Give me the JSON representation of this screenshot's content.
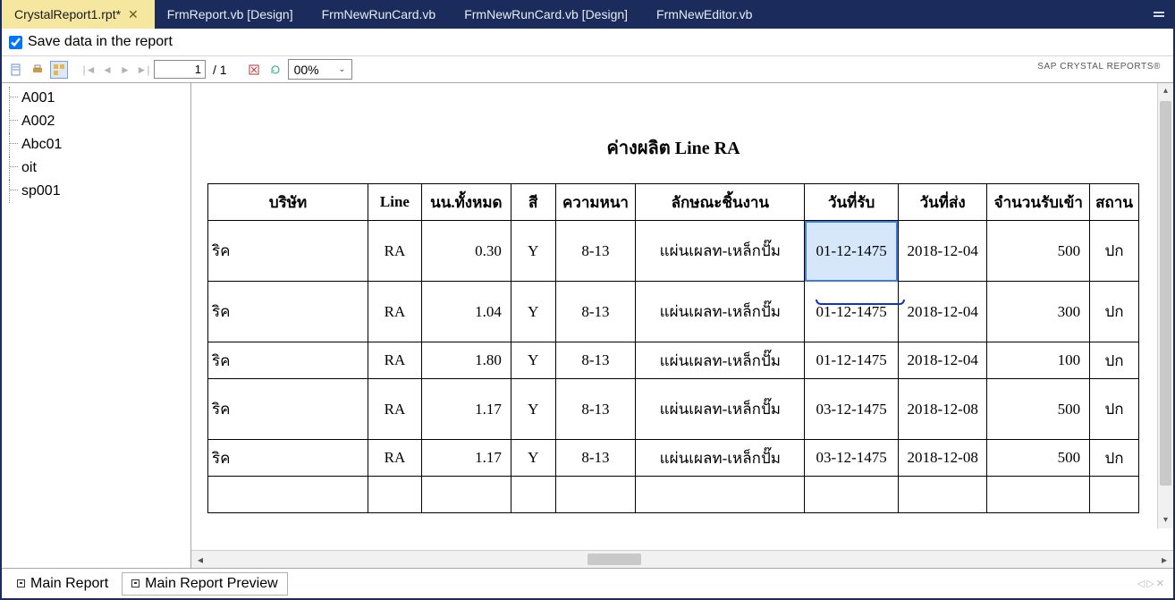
{
  "tabs": [
    {
      "label": "CrystalReport1.rpt*",
      "active": true
    },
    {
      "label": "FrmReport.vb [Design]",
      "active": false
    },
    {
      "label": "FrmNewRunCard.vb",
      "active": false
    },
    {
      "label": "FrmNewRunCard.vb [Design]",
      "active": false
    },
    {
      "label": "FrmNewEditor.vb",
      "active": false
    }
  ],
  "save_data_label": "Save data in the report",
  "save_data_checked": true,
  "page_current": "1",
  "page_total": "/ 1",
  "zoom": "00%",
  "brand": "SAP CRYSTAL REPORTS®",
  "tree_items": [
    "A001",
    "A002",
    "Abc01",
    "oit",
    "sp001"
  ],
  "report": {
    "title": "ค่างผลิต Line RA",
    "headers": [
      "บริษัท",
      "Line",
      "นน.ทั้งหมด",
      "สี",
      "ความหนา",
      "ลักษณะชิ้นงาน",
      "วันที่รับ",
      "วันที่ส่ง",
      "จำนวนรับเข้า",
      "สถาน"
    ],
    "rows": [
      {
        "company": "ริค",
        "line": "RA",
        "weight": "0.30",
        "color": "Y",
        "thick": "8-13",
        "desc": "แผ่นเผลท-เหล็กปั๊ม",
        "recv": "01-12-1475",
        "send": "2018-12-04",
        "qty": "500",
        "status": "ปก",
        "tall": true,
        "hl": true
      },
      {
        "company": "ริค",
        "line": "RA",
        "weight": "1.04",
        "color": "Y",
        "thick": "8-13",
        "desc": "แผ่นเผลท-เหล็กปั๊ม",
        "recv": "01-12-1475",
        "send": "2018-12-04",
        "qty": "300",
        "status": "ปก",
        "tall": true
      },
      {
        "company": "ริค",
        "line": "RA",
        "weight": "1.80",
        "color": "Y",
        "thick": "8-13",
        "desc": "แผ่นเผลท-เหล็กปั๊ม",
        "recv": "01-12-1475",
        "send": "2018-12-04",
        "qty": "100",
        "status": "ปก"
      },
      {
        "company": "ริค",
        "line": "RA",
        "weight": "1.17",
        "color": "Y",
        "thick": "8-13",
        "desc": "แผ่นเผลท-เหล็กปั๊ม",
        "recv": "03-12-1475",
        "send": "2018-12-08",
        "qty": "500",
        "status": "ปก",
        "tall": true
      },
      {
        "company": "ริค",
        "line": "RA",
        "weight": "1.17",
        "color": "Y",
        "thick": "8-13",
        "desc": "แผ่นเผลท-เหล็กปั๊ม",
        "recv": "03-12-1475",
        "send": "2018-12-08",
        "qty": "500",
        "status": "ปก"
      },
      {
        "company": "",
        "line": "",
        "weight": "",
        "color": "",
        "thick": "",
        "desc": "",
        "recv": "",
        "send": "",
        "qty": "",
        "status": ""
      }
    ]
  },
  "bottom_tabs": {
    "main": "Main Report",
    "preview": "Main Report Preview"
  }
}
